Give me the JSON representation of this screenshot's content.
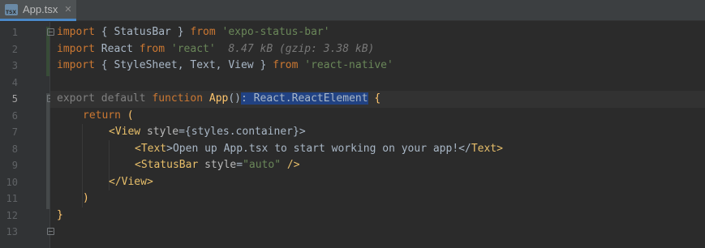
{
  "tab": {
    "label": "App.tsx",
    "icon": "tsx-file-icon",
    "close_icon": "close-icon"
  },
  "line_numbers": [
    "1",
    "2",
    "3",
    "4",
    "5",
    "6",
    "7",
    "8",
    "9",
    "10",
    "11",
    "12",
    "13"
  ],
  "code": {
    "l1": {
      "kw1": "import",
      "p1": " { StatusBar } ",
      "kw2": "from",
      "s1": " ",
      "str": "'expo-status-bar'"
    },
    "l2": {
      "kw1": "import",
      "p1": " React ",
      "kw2": "from",
      "s1": " ",
      "str": "'react'",
      "hint": "  8.47 kB (gzip: 3.38 kB)"
    },
    "l3": {
      "kw1": "import",
      "p1": " { StyleSheet, Text, View } ",
      "kw2": "from",
      "s1": " ",
      "str": "'react-native'"
    },
    "l5": {
      "kw1": "export",
      "s1": " ",
      "kw2": "default",
      "s2": " ",
      "kw3": "function",
      "s3": " ",
      "fn": "App",
      "p1": "()",
      "sel": ": React.ReactElement",
      "p2": " {"
    },
    "l6": {
      "kw1": "return",
      "p1": " ("
    },
    "l7": {
      "p1": "<",
      "tag": "View",
      "attr": " style",
      "p2": "={styles.container}>"
    },
    "l8": {
      "p1": "<",
      "tag": "Text",
      "p2": ">Open up App.tsx to start working on your app!</",
      "tag2": "Text",
      "p3": ">"
    },
    "l9": {
      "p1": "<",
      "tag": "StatusBar",
      "attr": " style",
      "p2": "=",
      "str": "\"auto\"",
      "p3": " />"
    },
    "l10": {
      "p1": "</",
      "tag": "View",
      "p2": ">"
    },
    "l11": {
      "p1": ")"
    },
    "l12": {
      "p1": "}"
    }
  },
  "colors": {
    "background": "#2b2b2b",
    "keyword": "#cc7832",
    "string": "#6a8759",
    "function": "#ffc66d",
    "tag": "#e8bf6a",
    "selection": "#214283",
    "tab_underline": "#4a88c7"
  }
}
